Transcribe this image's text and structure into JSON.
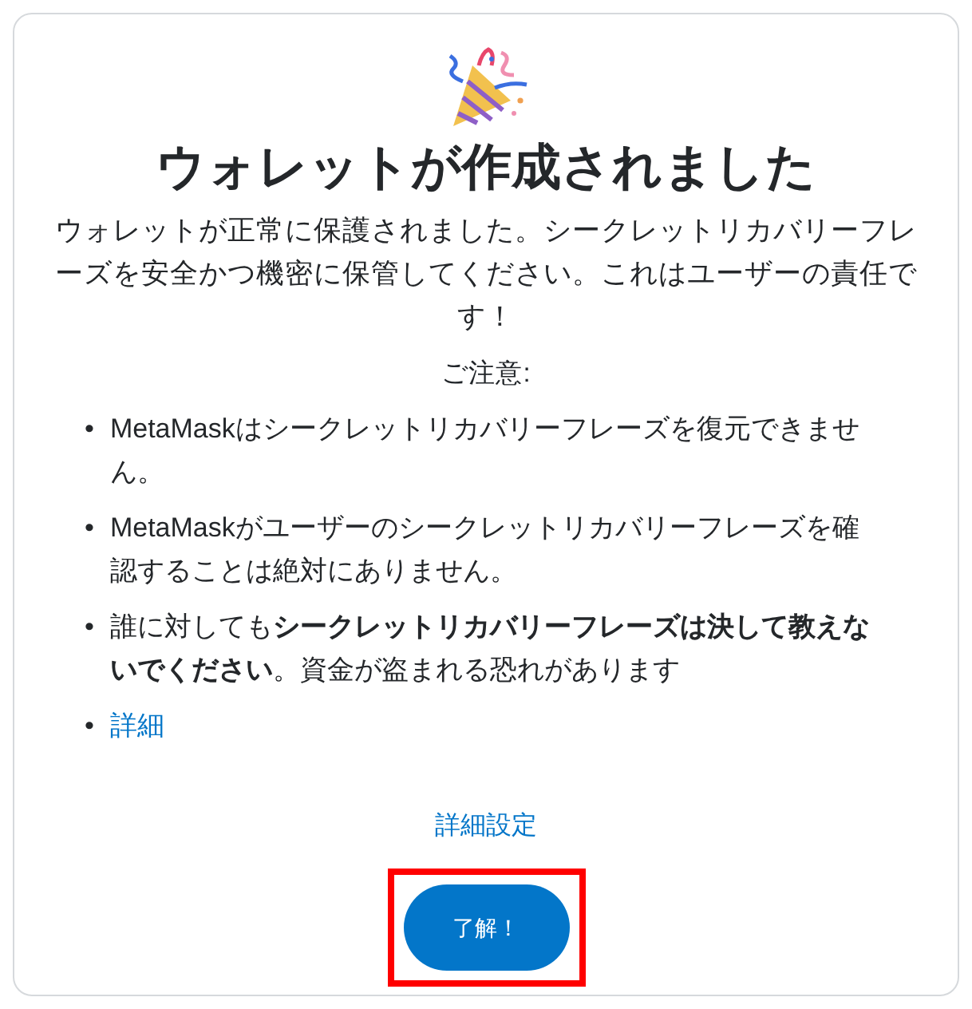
{
  "dialog": {
    "title": "ウォレットが作成されました",
    "message": "ウォレットが正常に保護されました。シークレットリカバリーフレーズを安全かつ機密に保管してください。これはユーザーの責任です！",
    "notice_heading": "ご注意:",
    "notes": [
      {
        "kind": "text",
        "marker": "•",
        "text": "MetaMaskはシークレットリカバリーフレーズを復元できません。"
      },
      {
        "kind": "text",
        "marker": "•",
        "text": "MetaMaskがユーザーのシークレットリカバリーフレーズを確認することは絶対にありません。"
      },
      {
        "kind": "text",
        "marker": "•",
        "text": "誰に対しても**シークレットリカバリーフレーズは決して教えないでください**。資金が盗まれる恐れがあります"
      },
      {
        "kind": "link",
        "marker": "•",
        "text": "詳細"
      }
    ],
    "advanced_link": "詳細設定",
    "confirm_button": {
      "label": "了解！",
      "highlighted": true
    }
  }
}
